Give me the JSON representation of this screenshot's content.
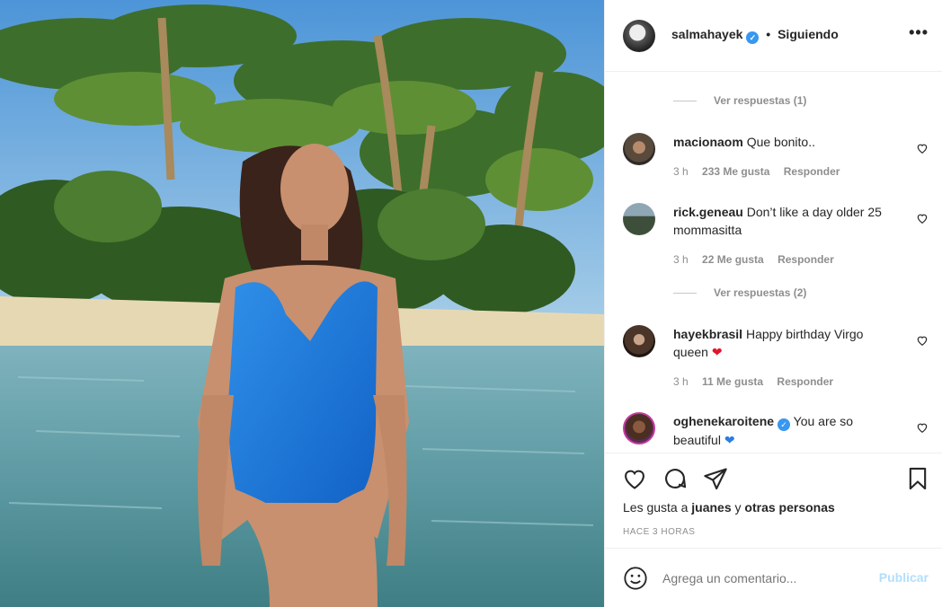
{
  "post": {
    "username": "salmahayek",
    "separator": "•",
    "follow_status": "Siguiendo",
    "more_label": "•••"
  },
  "comments": [
    {
      "type": "replies",
      "label": "Ver respuestas (1)"
    },
    {
      "type": "comment",
      "username": "macionaom",
      "text": "Que bonito..",
      "time": "3 h",
      "likes": "233 Me gusta",
      "reply": "Responder",
      "avatar": "avatar-photo"
    },
    {
      "type": "comment",
      "username": "rick.geneau",
      "text": "Don’t like a day older 25 mommasitta",
      "time": "3 h",
      "likes": "22 Me gusta",
      "reply": "Responder",
      "avatar": "avatar-photo"
    },
    {
      "type": "replies",
      "label": "Ver respuestas (2)"
    },
    {
      "type": "comment",
      "username": "hayekbrasil",
      "text": "Happy birthday Virgo queen",
      "emoji": "red-heart",
      "time": "3 h",
      "likes": "11 Me gusta",
      "reply": "Responder",
      "avatar": "avatar-photo"
    },
    {
      "type": "comment",
      "username": "oghenekaroitene",
      "verified": true,
      "text": "You are so beautiful",
      "emoji": "blue-heart",
      "avatar": "avatar-photo"
    }
  ],
  "actions": {
    "icons": [
      "heart-outline-icon",
      "comment-icon",
      "share-icon",
      "bookmark-icon"
    ],
    "likes_prefix": "Les gusta a",
    "likes_user": "juanes",
    "likes_join": "y",
    "likes_others": "otras personas",
    "time_ago": "HACE 3 HORAS"
  },
  "add_comment": {
    "emoji_icon": "smiley-icon",
    "placeholder": "Agrega un comentario...",
    "publish_label": "Publicar"
  },
  "colors": {
    "accent": "#0095f6",
    "publish_disabled": "#b2dffc",
    "muted": "#8e8e8e",
    "verified": "#3897f0"
  }
}
